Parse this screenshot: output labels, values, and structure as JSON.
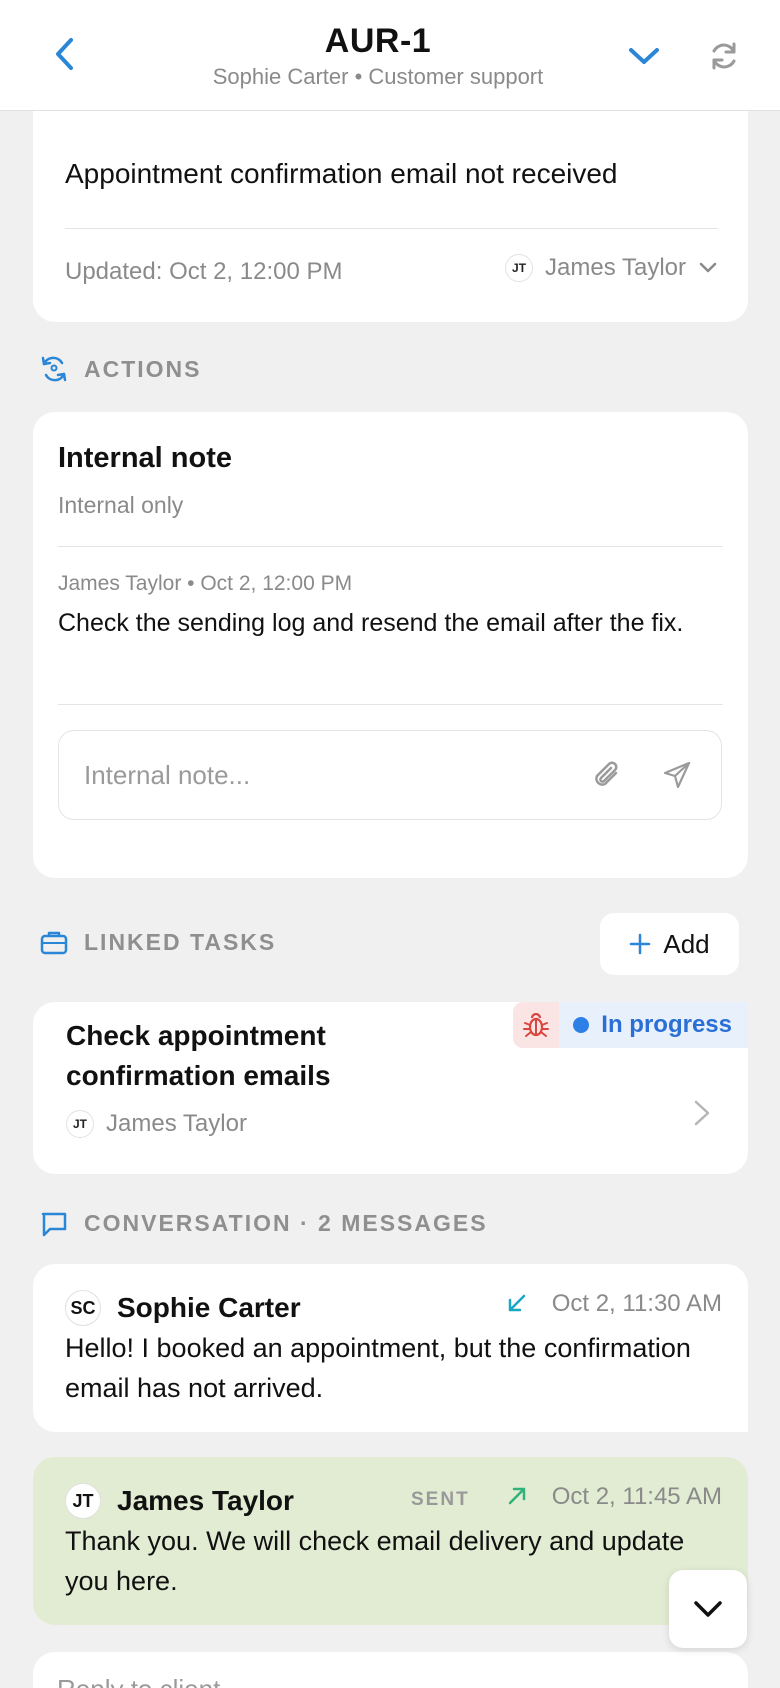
{
  "header": {
    "title": "AUR-1",
    "subtitle": "Sophie Carter • Customer support"
  },
  "ticket": {
    "subject": "Appointment confirmation email not received",
    "updated": "Updated: Oct 2, 12:00 PM",
    "assignee_initials": "JT",
    "assignee_name": "James Taylor"
  },
  "actions": {
    "section_label": "ACTIONS",
    "note_title": "Internal note",
    "note_subtitle": "Internal only",
    "note_meta": "James Taylor • Oct 2, 12:00 PM",
    "note_body": "Check the sending log and resend the email after the fix.",
    "note_placeholder": "Internal note..."
  },
  "linked_tasks": {
    "section_label": "LINKED TASKS",
    "add_label": "Add",
    "task": {
      "title": "Check appointment confirmation emails",
      "status": "In progress",
      "assignee_initials": "JT",
      "assignee_name": "James Taylor"
    }
  },
  "conversation": {
    "section_label": "CONVERSATION · 2 MESSAGES",
    "messages": [
      {
        "initials": "SC",
        "name": "Sophie Carter",
        "direction": "incoming",
        "time": "Oct 2, 11:30 AM",
        "body": "Hello! I booked an appointment, but the confirmation email has not arrived."
      },
      {
        "initials": "JT",
        "name": "James Taylor",
        "badge": "SENT",
        "direction": "outgoing",
        "time": "Oct 2, 11:45 AM",
        "body": "Thank you. We will check email delivery and update you here."
      }
    ],
    "reply_placeholder": "Reply to client..."
  },
  "colors": {
    "accent": "#2a86d6",
    "status_blue": "#2f7fe8",
    "outgoing_bg": "#e2ecd2",
    "incoming_arrow": "#1aa7c4",
    "outgoing_arrow": "#2fb37a",
    "bug_red": "#d9463f"
  }
}
